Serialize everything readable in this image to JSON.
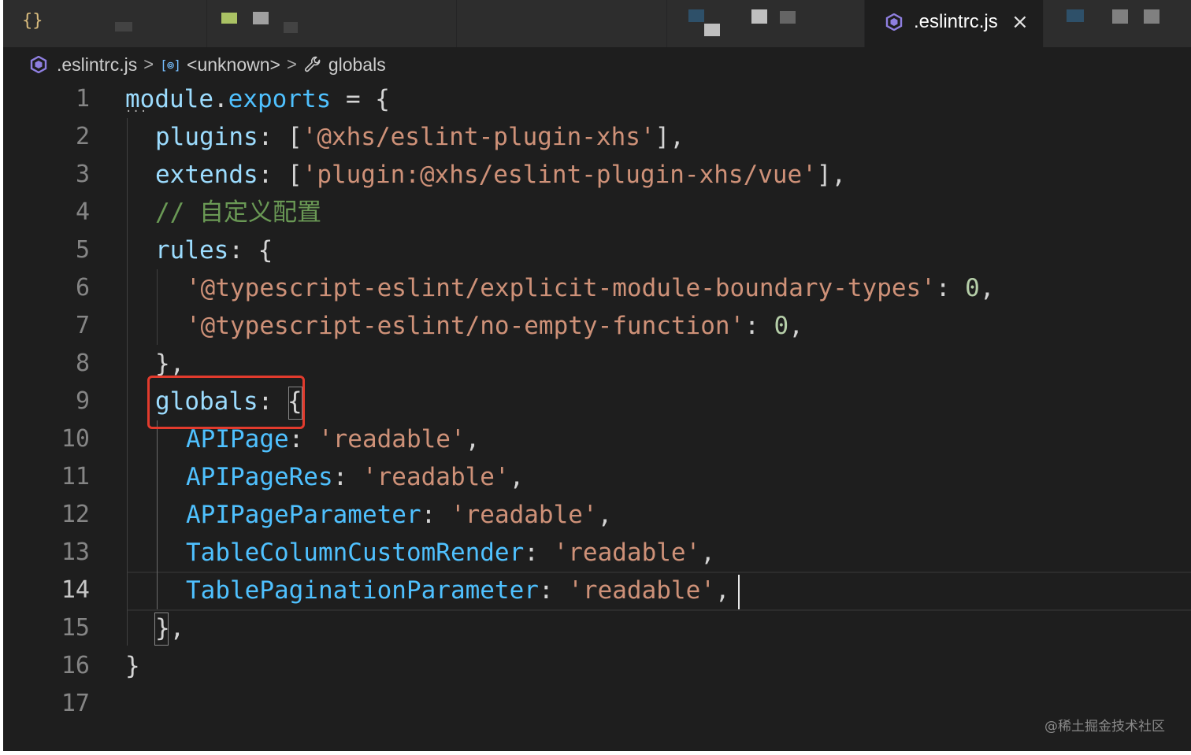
{
  "tab": {
    "left_icon": "{}",
    "active_title": ".eslintrc.js",
    "close_glyph": "×",
    "icon": "eslint-icon"
  },
  "breadcrumb": {
    "file": ".eslintrc.js",
    "symbol_icon": "[⊚]",
    "symbol": "<unknown>",
    "property": "globals",
    "separator": ">"
  },
  "editor": {
    "active_line": 14,
    "line_numbers": [
      "1",
      "2",
      "3",
      "4",
      "5",
      "6",
      "7",
      "8",
      "9",
      "10",
      "11",
      "12",
      "13",
      "14",
      "15",
      "16",
      "17"
    ],
    "colors": {
      "background": "#1e1e1e",
      "string": "#ce9178",
      "variable": "#9cdcfe",
      "property": "#4fc1ff",
      "number": "#b5cea8",
      "comment": "#6a9955",
      "highlight_box": "#e23b2d"
    },
    "code": {
      "l1": {
        "module": "module",
        "dot": ".",
        "exports": "exports",
        "rest": " = {"
      },
      "l2": {
        "key": "plugins",
        "colon": ": [",
        "str": "'@xhs/eslint-plugin-xhs'",
        "end": "],"
      },
      "l3": {
        "key": "extends",
        "colon": ": [",
        "str": "'plugin:@xhs/eslint-plugin-xhs/vue'",
        "end": "],"
      },
      "l4": {
        "comment": "// 自定义配置"
      },
      "l5": {
        "key": "rules",
        "colon": ": {"
      },
      "l6": {
        "str": "'@typescript-eslint/explicit-module-boundary-types'",
        "colon": ": ",
        "num": "0",
        "end": ","
      },
      "l7": {
        "str": "'@typescript-eslint/no-empty-function'",
        "colon": ": ",
        "num": "0",
        "end": ","
      },
      "l8": {
        "text": "},"
      },
      "l9": {
        "key": "globals",
        "colon": ": ",
        "brace": "{"
      },
      "l10": {
        "key": "APIPage",
        "colon": ": ",
        "str": "'readable'",
        "end": ","
      },
      "l11": {
        "key": "APIPageRes",
        "colon": ": ",
        "str": "'readable'",
        "end": ","
      },
      "l12": {
        "key": "APIPageParameter",
        "colon": ": ",
        "str": "'readable'",
        "end": ","
      },
      "l13": {
        "key": "TableColumnCustomRender",
        "colon": ": ",
        "str": "'readable'",
        "end": ","
      },
      "l14": {
        "key": "TablePaginationParameter",
        "colon": ": ",
        "str": "'readable'",
        "end": ","
      },
      "l15": {
        "brace": "}",
        "end": ","
      },
      "l16": {
        "text": "}"
      },
      "l17": {
        "text": ""
      }
    },
    "fold_marker": "···"
  },
  "watermark": "@稀土掘金技术社区"
}
